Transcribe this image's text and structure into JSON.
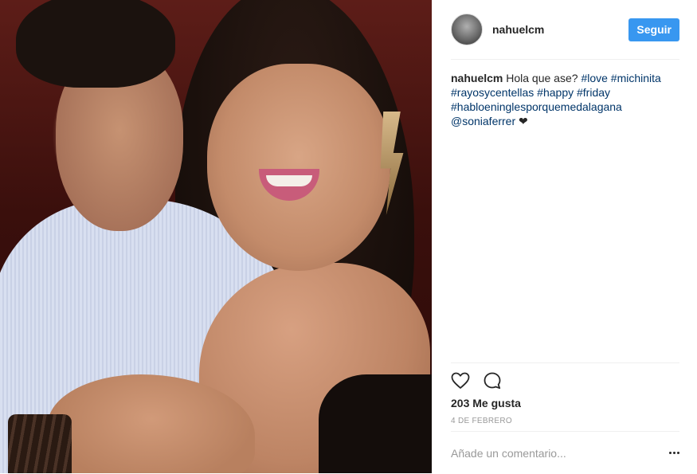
{
  "header": {
    "username": "nahuelcm",
    "follow_label": "Seguir"
  },
  "caption": {
    "username": "nahuelcm",
    "text": "Hola que ase?",
    "tags": [
      "#love",
      "#michinita",
      "#rayosycentellas",
      "#happy",
      "#friday",
      "#habloeninglesporquemedalagana"
    ],
    "mention": "@soniaferrer",
    "emoji": "❤"
  },
  "actions": {
    "like_icon": "heart-outline-icon",
    "comment_icon": "comment-bubble-icon"
  },
  "likes": "203 Me gusta",
  "date": "4 DE FEBRERO",
  "comment_box": {
    "placeholder": "Añade un comentario...",
    "more_icon": "more-options-icon"
  },
  "colors": {
    "accent": "#3897f0",
    "hashtag": "#003569",
    "muted": "#999999",
    "divider": "#efefef"
  }
}
